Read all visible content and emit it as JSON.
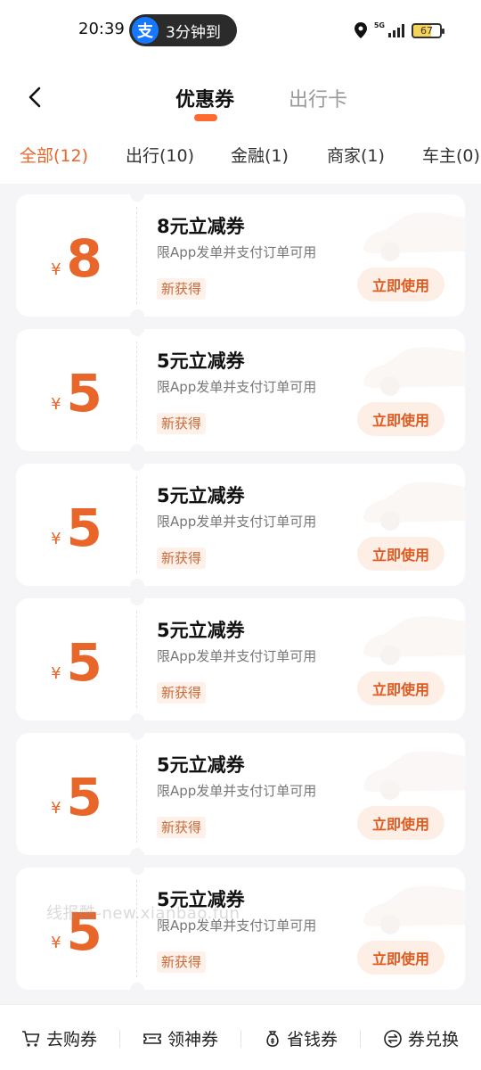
{
  "status_bar": {
    "time": "20:39",
    "alipay_badge": "3分钟到",
    "alipay_logo_char": "支",
    "network": "5G",
    "battery": "67"
  },
  "header": {
    "tabs": [
      {
        "label": "优惠券",
        "active": true
      },
      {
        "label": "出行卡",
        "active": false
      }
    ]
  },
  "filters": [
    {
      "label": "全部(12)",
      "active": true
    },
    {
      "label": "出行(10)",
      "active": false
    },
    {
      "label": "金融(1)",
      "active": false
    },
    {
      "label": "商家(1)",
      "active": false
    },
    {
      "label": "车主(0)",
      "active": false
    }
  ],
  "coupons": [
    {
      "currency": "¥",
      "amount": "8",
      "title": "8元立减券",
      "desc": "限App发单并支付订单可用",
      "badge": "新获得",
      "action": "立即使用"
    },
    {
      "currency": "¥",
      "amount": "5",
      "title": "5元立减券",
      "desc": "限App发单并支付订单可用",
      "badge": "新获得",
      "action": "立即使用"
    },
    {
      "currency": "¥",
      "amount": "5",
      "title": "5元立减券",
      "desc": "限App发单并支付订单可用",
      "badge": "新获得",
      "action": "立即使用"
    },
    {
      "currency": "¥",
      "amount": "5",
      "title": "5元立减券",
      "desc": "限App发单并支付订单可用",
      "badge": "新获得",
      "action": "立即使用"
    },
    {
      "currency": "¥",
      "amount": "5",
      "title": "5元立减券",
      "desc": "限App发单并支付订单可用",
      "badge": "新获得",
      "action": "立即使用"
    },
    {
      "currency": "¥",
      "amount": "5",
      "title": "5元立减券",
      "desc": "限App发单并支付订单可用",
      "badge": "新获得",
      "action": "立即使用"
    }
  ],
  "watermark": "线报酷-new.xianbao.fun",
  "bottom_nav": [
    {
      "label": "去购券",
      "icon": "cart-icon"
    },
    {
      "label": "领神券",
      "icon": "ticket-icon"
    },
    {
      "label": "省钱券",
      "icon": "money-bag-icon"
    },
    {
      "label": "券兑换",
      "icon": "exchange-icon"
    }
  ],
  "colors": {
    "accent": "#e8662a",
    "tab_indicator": "#ff6a2f",
    "page_bg": "#f5f5f7"
  }
}
